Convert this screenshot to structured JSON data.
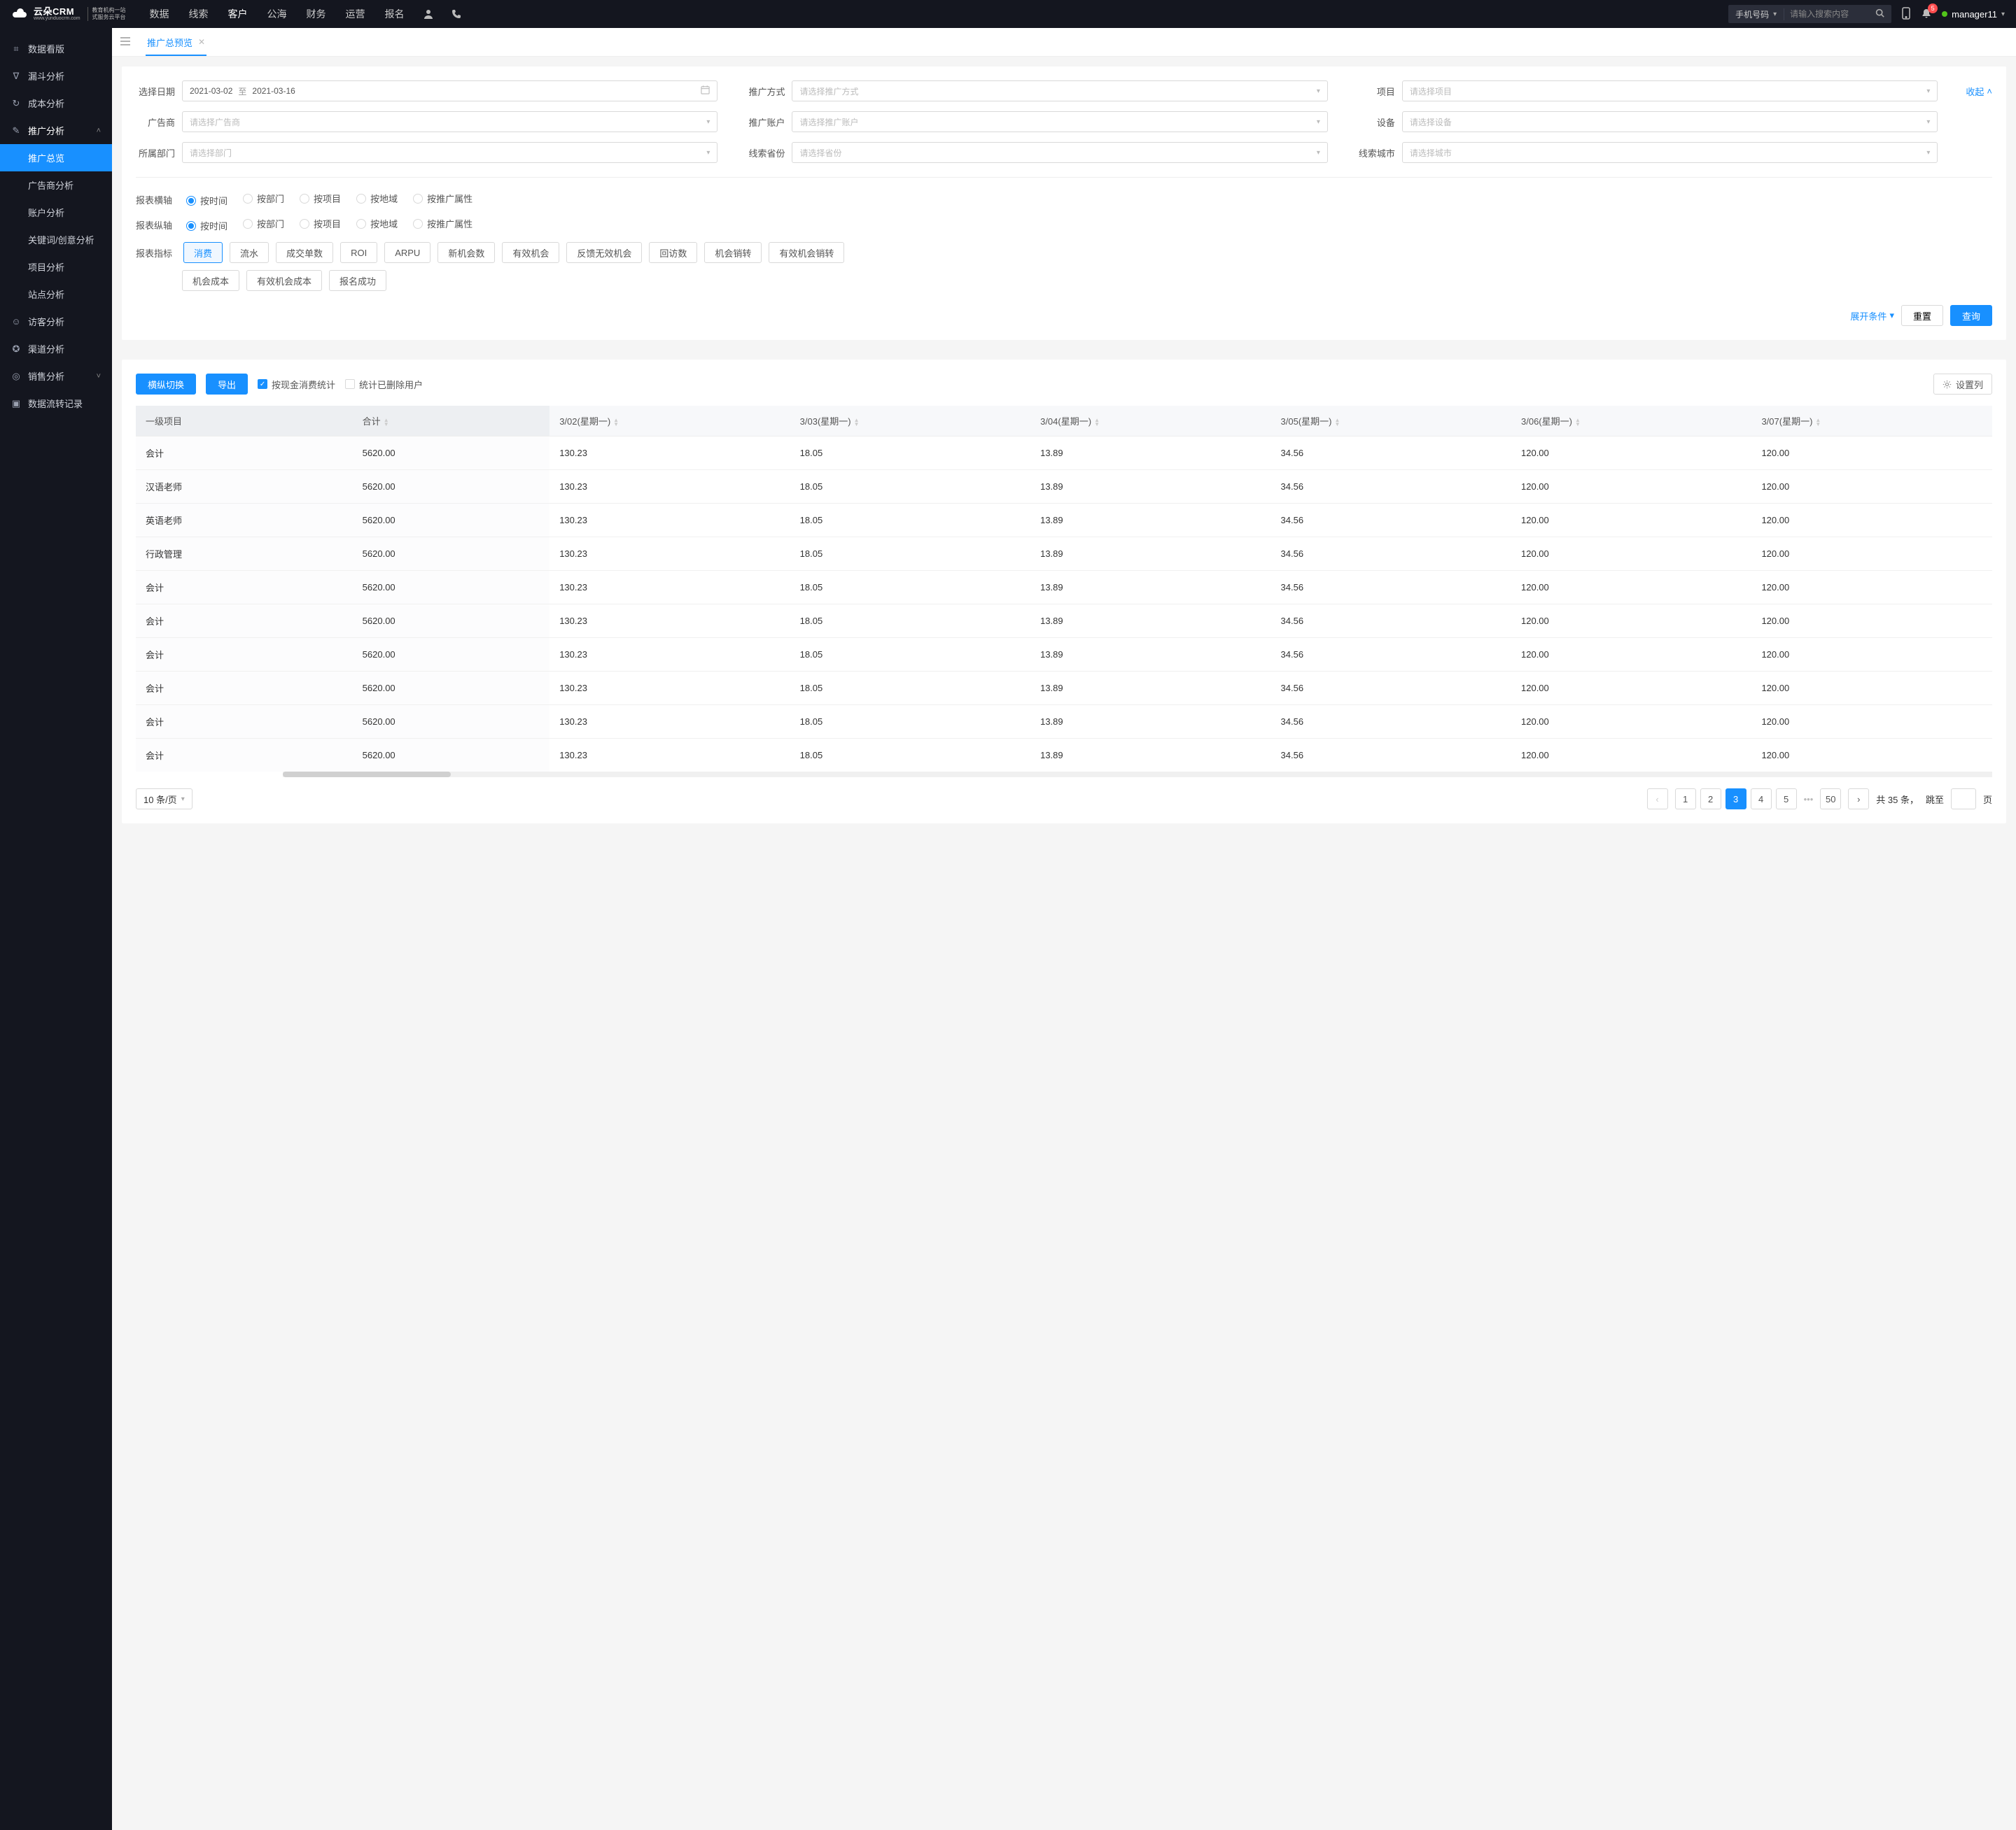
{
  "header": {
    "logo_main": "云朵CRM",
    "logo_sub": "www.yunduocrm.com",
    "logo_side1": "教育机构一站",
    "logo_side2": "式服务云平台",
    "nav": [
      "数据",
      "线索",
      "客户",
      "公海",
      "财务",
      "运营",
      "报名"
    ],
    "nav_active_index": 2,
    "search_type": "手机号码",
    "search_placeholder": "请输入搜索内容",
    "badge_count": "5",
    "username": "manager11"
  },
  "sidebar": {
    "items": [
      {
        "icon": "⌗",
        "label": "数据看版"
      },
      {
        "icon": "∇",
        "label": "漏斗分析"
      },
      {
        "icon": "↻",
        "label": "成本分析"
      },
      {
        "icon": "✎",
        "label": "推广分析",
        "expanded": true,
        "children": [
          {
            "label": "推广总览",
            "active": true
          },
          {
            "label": "广告商分析"
          },
          {
            "label": "账户分析"
          },
          {
            "label": "关键词/创意分析"
          },
          {
            "label": "项目分析"
          },
          {
            "label": "站点分析"
          }
        ]
      },
      {
        "icon": "☺",
        "label": "访客分析"
      },
      {
        "icon": "✪",
        "label": "渠道分析"
      },
      {
        "icon": "◎",
        "label": "销售分析",
        "has_chev": true
      },
      {
        "icon": "▣",
        "label": "数据流转记录"
      }
    ]
  },
  "tabs": {
    "tab_label": "推广总预览"
  },
  "filters": {
    "date_label": "选择日期",
    "date_from": "2021-03-02",
    "date_sep": "至",
    "date_to": "2021-03-16",
    "fields": {
      "method": {
        "label": "推广方式",
        "placeholder": "请选择推广方式"
      },
      "project": {
        "label": "项目",
        "placeholder": "请选择项目"
      },
      "advertiser": {
        "label": "广告商",
        "placeholder": "请选择广告商"
      },
      "account": {
        "label": "推广账户",
        "placeholder": "请选择推广账户"
      },
      "device": {
        "label": "设备",
        "placeholder": "请选择设备"
      },
      "department": {
        "label": "所属部门",
        "placeholder": "请选择部门"
      },
      "province": {
        "label": "线索省份",
        "placeholder": "请选择省份"
      },
      "city": {
        "label": "线索城市",
        "placeholder": "请选择城市"
      }
    },
    "collapse": "收起"
  },
  "options": {
    "h_axis_label": "报表横轴",
    "v_axis_label": "报表纵轴",
    "axis_opts": [
      "按时间",
      "按部门",
      "按项目",
      "按地域",
      "按推广属性"
    ],
    "metric_label": "报表指标",
    "metrics_row1": [
      "消费",
      "流水",
      "成交单数",
      "ROI",
      "ARPU",
      "新机会数",
      "有效机会",
      "反馈无效机会",
      "回访数",
      "机会销转",
      "有效机会销转"
    ],
    "metrics_row2": [
      "机会成本",
      "有效机会成本",
      "报名成功"
    ],
    "expand": "展开条件",
    "reset": "重置",
    "query": "查询"
  },
  "toolbar": {
    "swap": "横纵切换",
    "export": "导出",
    "cash_stat": "按现金消费统计",
    "deleted_stat": "统计已删除用户",
    "settings": "设置列"
  },
  "table": {
    "headers_fixed": [
      "一级项目",
      "合计"
    ],
    "headers_scroll": [
      "3/02(星期一)",
      "3/03(星期一)",
      "3/04(星期一)",
      "3/05(星期一)",
      "3/06(星期一)",
      "3/07(星期一)"
    ],
    "row_labels": [
      "会计",
      "汉语老师",
      "英语老师",
      "行政管理",
      "会计",
      "会计",
      "会计",
      "会计",
      "会计",
      "会计"
    ],
    "total_col": "5620.00",
    "data_cols": [
      "130.23",
      "18.05",
      "13.89",
      "34.56",
      "120.00",
      "120.00"
    ]
  },
  "pager": {
    "page_size": "10 条/页",
    "total_prefix": "共 ",
    "total_count": "35",
    "total_suffix": " 条，",
    "jump_prefix": "跳至",
    "jump_suffix": "页",
    "pages": [
      "1",
      "2",
      "3",
      "4",
      "5"
    ],
    "pages_last": "50",
    "active_index": 2
  }
}
